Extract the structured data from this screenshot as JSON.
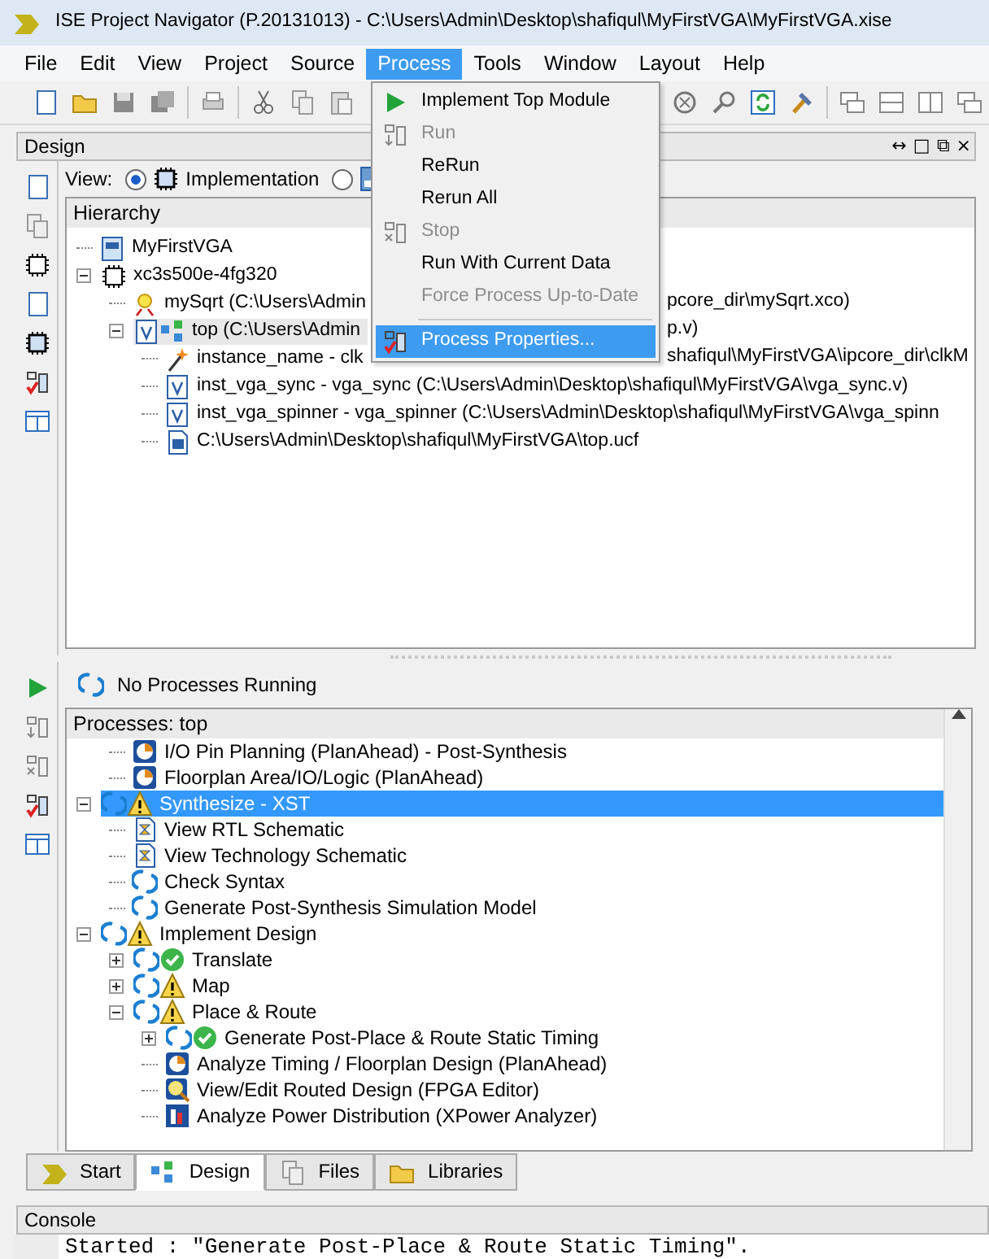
{
  "window": {
    "title": "ISE Project Navigator (P.20131013) - C:\\Users\\Admin\\Desktop\\shafiqul\\MyFirstVGA\\MyFirstVGA.xise"
  },
  "menu_bar": [
    {
      "label": "File",
      "selected": false
    },
    {
      "label": "Edit",
      "selected": false
    },
    {
      "label": "View",
      "selected": false
    },
    {
      "label": "Project",
      "selected": false
    },
    {
      "label": "Source",
      "selected": false
    },
    {
      "label": "Process",
      "selected": true
    },
    {
      "label": "Tools",
      "selected": false
    },
    {
      "label": "Window",
      "selected": false
    },
    {
      "label": "Layout",
      "selected": false
    },
    {
      "label": "Help",
      "selected": false
    }
  ],
  "process_menu": [
    {
      "label": "Implement Top Module",
      "kind": "play",
      "disabled": false,
      "selected": false
    },
    {
      "label": "Run",
      "kind": "run",
      "disabled": true,
      "selected": false
    },
    {
      "label": "ReRun",
      "disabled": false,
      "selected": false
    },
    {
      "label": "Rerun All",
      "disabled": false,
      "selected": false
    },
    {
      "label": "Stop",
      "kind": "stop",
      "disabled": true,
      "selected": false
    },
    {
      "label": "Run With Current Data",
      "disabled": false,
      "selected": false
    },
    {
      "label": "Force Process Up-to-Date",
      "disabled": true,
      "selected": false
    },
    {
      "label": "Process Properties...",
      "kind": "properties",
      "separator_before": true,
      "disabled": false,
      "selected": true
    }
  ],
  "design_panel": {
    "title": "Design",
    "controls": [
      "↔",
      "□",
      "⧉",
      "×"
    ],
    "view_label": "View:",
    "view_options": [
      {
        "label": "Implementation",
        "selected": true
      },
      {
        "selected": false
      }
    ],
    "hierarchy": {
      "title": "Hierarchy",
      "nodes": [
        {
          "label": "MyFirstVGA",
          "kind": "project",
          "selected": false
        },
        {
          "label": "xc3s500e-4fg320",
          "kind": "device",
          "expanded": true,
          "selected": false,
          "children": [
            {
              "label": "mySqrt (C:\\Users\\Admin",
              "tail": "pcore_dir\\mySqrt.xco)",
              "kind": "core",
              "selected": false
            },
            {
              "label": "top (C:\\Users\\Admin",
              "tail": "p.v)",
              "kind": "top",
              "expanded": true,
              "selected": true,
              "children": [
                {
                  "label": "instance_name - clk",
                  "tail": "shafiqul\\MyFirstVGA\\ipcore_dir\\clkM",
                  "kind": "wizard",
                  "selected": false
                },
                {
                  "label": "inst_vga_sync - vga_sync (C:\\Users\\Admin\\Desktop\\shafiqul\\MyFirstVGA\\vga_sync.v)",
                  "kind": "verilog",
                  "selected": false
                },
                {
                  "label": "inst_vga_spinner - vga_spinner (C:\\Users\\Admin\\Desktop\\shafiqul\\MyFirstVGA\\vga_spinn",
                  "kind": "verilog",
                  "selected": false
                },
                {
                  "label": "C:\\Users\\Admin\\Desktop\\shafiqul\\MyFirstVGA\\top.ucf",
                  "kind": "ucf",
                  "selected": false
                }
              ]
            }
          ]
        }
      ]
    }
  },
  "processes_panel": {
    "status": "No Processes Running",
    "title": "Processes: top",
    "items": [
      {
        "children": [
          {
            "label": "I/O Pin Planning (PlanAhead) - Post-Synthesis",
            "kind": "planahead",
            "selected": false
          },
          {
            "label": "Floorplan Area/IO/Logic (PlanAhead)",
            "kind": "planahead",
            "selected": false
          }
        ]
      },
      {
        "label": "Synthesize - XST",
        "kind": "process_warning",
        "expanded": true,
        "selected": true,
        "children": [
          {
            "label": "View RTL Schematic",
            "kind": "schematic",
            "selected": false
          },
          {
            "label": "View Technology Schematic",
            "kind": "schematic",
            "selected": false
          },
          {
            "label": "Check Syntax",
            "kind": "process",
            "selected": false
          },
          {
            "label": "Generate Post-Synthesis Simulation Model",
            "kind": "process",
            "selected": false
          }
        ]
      },
      {
        "label": "Implement Design",
        "kind": "process_warning",
        "expanded": true,
        "selected": false,
        "children": [
          {
            "label": "Translate",
            "kind": "process_ok",
            "expanded": false,
            "selected": false
          },
          {
            "label": "Map",
            "kind": "process_warning",
            "expanded": false,
            "selected": false
          },
          {
            "label": "Place & Route",
            "kind": "process_warning",
            "expanded": true,
            "selected": false,
            "children": [
              {
                "label": "Generate Post-Place & Route Static Timing",
                "kind": "process_ok",
                "expanded": false,
                "selected": false
              },
              {
                "label": "Analyze Timing / Floorplan Design (PlanAhead)",
                "kind": "planahead",
                "selected": false
              },
              {
                "label": "View/Edit Routed Design (FPGA Editor)",
                "kind": "fpga_editor",
                "selected": false
              },
              {
                "label": "Analyze Power Distribution (XPower Analyzer)",
                "kind": "xpower",
                "selected": false
              }
            ]
          }
        ]
      }
    ]
  },
  "tabs": [
    {
      "label": "Start",
      "selected": false
    },
    {
      "label": "Design",
      "selected": true
    },
    {
      "label": "Files",
      "selected": false
    },
    {
      "label": "Libraries",
      "selected": false
    }
  ],
  "console": {
    "title": "Console",
    "lines": [
      "Started : \"Generate Post-Place & Route Static Timing\"."
    ]
  }
}
